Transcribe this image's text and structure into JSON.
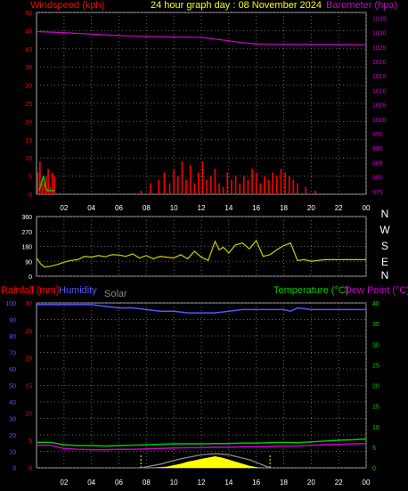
{
  "header": {
    "windspeed_label": "Windspeed (kph)",
    "title": "24 hour graph day : 08 November 2024",
    "barometer_label": "Barometer (hpa)"
  },
  "lower_header": {
    "rainfall_label": "Rainfall (mm)",
    "humidity_label": "Humidity",
    "solar_label": "Solar",
    "temperature_label": "Temperature (°C)",
    "dewpoint_label": "Dew Point (°C)"
  },
  "colors": {
    "wind": "#ff0000",
    "gust_green": "#00cc00",
    "barometer": "#cc00cc",
    "direction": "#cccc00",
    "humidity": "#5555ff",
    "temperature": "#00cc00",
    "dewpoint": "#cc00cc",
    "rain": "#ff0000",
    "solar": "#ffff00",
    "solar_max": "#888888",
    "grid": "#666666",
    "axis": "#aaaaaa"
  },
  "chart_data": [
    {
      "type": "line",
      "name": "wind-and-barometer",
      "x_ticks": [
        "02",
        "04",
        "06",
        "08",
        "10",
        "12",
        "14",
        "16",
        "18",
        "20",
        "22",
        "00"
      ],
      "y_left": {
        "ticks": [
          0,
          5,
          10,
          15,
          20,
          25,
          30,
          35,
          40,
          45,
          50
        ],
        "range": [
          0,
          50
        ]
      },
      "y_right": {
        "ticks": [
          975,
          980,
          985,
          990,
          995,
          1000,
          1005,
          1010,
          1015,
          1020,
          1025,
          1030,
          1035
        ],
        "range": [
          974,
          1037
        ]
      },
      "series": [
        {
          "name": "Barometer (hpa)",
          "x": [
            0,
            2,
            4,
            6,
            8,
            10,
            12,
            14,
            15,
            16,
            17,
            18,
            20,
            22,
            24
          ],
          "values": [
            1030.4,
            1030.0,
            1029.5,
            1029.0,
            1028.7,
            1028.5,
            1028.4,
            1027.2,
            1026.5,
            1026.1,
            1026.0,
            1026.0,
            1025.9,
            1025.9,
            1025.8
          ]
        },
        {
          "name": "Windspeed (kph)",
          "x": [
            0.1,
            0.25,
            0.4,
            0.55,
            0.7,
            0.85,
            1.0,
            1.15,
            1.3,
            7.6,
            8.3,
            8.9,
            9.3,
            9.7,
            10.0,
            10.3,
            10.6,
            10.9,
            11.2,
            11.5,
            11.8,
            12.1,
            12.4,
            12.7,
            13.0,
            13.3,
            13.6,
            13.9,
            14.2,
            14.5,
            14.8,
            15.1,
            15.4,
            15.7,
            16.0,
            16.3,
            16.6,
            16.9,
            17.2,
            17.5,
            17.8,
            18.1,
            18.4,
            18.7,
            19.0,
            19.6,
            20.3
          ],
          "values": [
            6,
            9,
            4,
            3,
            5,
            7,
            2,
            6,
            5,
            1,
            3,
            4,
            6,
            3,
            7,
            5,
            9,
            4,
            8,
            3,
            6,
            9,
            4,
            5,
            7,
            3,
            2,
            6,
            4,
            5,
            3,
            5,
            4,
            7,
            6,
            3,
            5,
            4,
            6,
            5,
            7,
            6,
            5,
            4,
            3,
            2,
            1
          ]
        },
        {
          "name": "Wind Gust",
          "x": [
            0.2,
            0.35,
            0.5,
            0.65,
            0.8,
            1.3
          ],
          "values": [
            1,
            3,
            5,
            2,
            1,
            1
          ]
        }
      ]
    },
    {
      "type": "line",
      "name": "wind-direction",
      "y_ticks": [
        0,
        90,
        180,
        270,
        360
      ],
      "compass": [
        "N",
        "W",
        "S",
        "E",
        "N"
      ],
      "range": [
        0,
        360
      ],
      "series": [
        {
          "name": "Wind Direction",
          "x": [
            0,
            0.3,
            0.6,
            1.0,
            1.5,
            2.0,
            2.5,
            3.0,
            3.5,
            4.0,
            4.5,
            5.0,
            5.5,
            6.0,
            6.5,
            7.0,
            7.5,
            8.0,
            8.5,
            9.0,
            9.5,
            10.0,
            10.5,
            11.0,
            11.5,
            12.0,
            12.5,
            13.0,
            13.3,
            13.6,
            14.0,
            14.5,
            15.0,
            15.5,
            16.0,
            16.5,
            17.0,
            17.5,
            18.0,
            18.5,
            19.0,
            19.5,
            20.0,
            21.0,
            22.0,
            23.0,
            24.0
          ],
          "values": [
            110,
            75,
            55,
            60,
            70,
            85,
            95,
            100,
            120,
            115,
            125,
            118,
            130,
            128,
            120,
            135,
            110,
            125,
            105,
            120,
            115,
            110,
            130,
            105,
            150,
            115,
            95,
            210,
            160,
            175,
            140,
            190,
            200,
            165,
            215,
            120,
            130,
            160,
            185,
            200,
            95,
            100,
            90,
            100,
            100,
            100,
            100
          ]
        }
      ]
    },
    {
      "type": "line",
      "name": "rain-humidity-temperature",
      "x_ticks": [
        "02",
        "04",
        "06",
        "08",
        "10",
        "12",
        "14",
        "16",
        "18",
        "20",
        "22",
        "00"
      ],
      "humidity_axis": {
        "ticks": [
          0,
          10,
          20,
          30,
          40,
          50,
          60,
          70,
          80,
          90,
          100
        ],
        "range": [
          0,
          100
        ]
      },
      "rain_axis": {
        "ticks": [
          0,
          5,
          10,
          15,
          20,
          25,
          30
        ],
        "range": [
          0,
          30
        ]
      },
      "temp_axis": {
        "ticks": [
          0,
          5,
          10,
          15,
          20,
          25,
          30,
          35,
          40
        ],
        "range": [
          0,
          40
        ]
      },
      "series": [
        {
          "name": "Humidity",
          "x": [
            0,
            2,
            4,
            5,
            6,
            7,
            8,
            9,
            10,
            11,
            12,
            13,
            14,
            15,
            16,
            17,
            18,
            18.5,
            19,
            20,
            21,
            22,
            23,
            24
          ],
          "values": [
            99,
            99,
            99,
            98,
            97,
            97,
            96,
            95,
            95,
            94,
            94,
            94,
            95,
            96,
            96,
            96,
            96,
            95,
            97,
            96,
            96,
            96,
            96,
            96
          ]
        },
        {
          "name": "Temperature (°C)",
          "x": [
            0,
            1,
            2,
            3,
            4,
            5,
            6,
            7,
            8,
            9,
            10,
            11,
            12,
            13,
            14,
            15,
            16,
            17,
            18,
            19,
            20,
            21,
            22,
            23,
            24
          ],
          "values": [
            6.2,
            6.2,
            5.6,
            5.4,
            5.4,
            5.3,
            5.4,
            5.5,
            5.6,
            5.7,
            5.8,
            5.8,
            5.8,
            5.9,
            5.9,
            6.0,
            6.0,
            6.1,
            6.2,
            6.1,
            6.3,
            6.5,
            6.7,
            6.8,
            7.0
          ]
        },
        {
          "name": "Dew Point (°C)",
          "x": [
            0,
            1,
            2,
            3,
            4,
            5,
            6,
            7,
            8,
            9,
            10,
            11,
            12,
            13,
            14,
            15,
            16,
            17,
            18,
            19,
            20,
            21,
            22,
            23,
            24
          ],
          "values": [
            5.5,
            5.5,
            4.7,
            4.5,
            4.4,
            4.4,
            4.5,
            4.5,
            4.6,
            4.7,
            4.8,
            4.9,
            4.9,
            5.0,
            5.0,
            5.1,
            5.1,
            5.2,
            5.3,
            5.3,
            5.5,
            5.6,
            5.7,
            5.8,
            5.9
          ]
        },
        {
          "name": "Solar",
          "x": [
            7.7,
            8.5,
            9.5,
            10.5,
            11.0,
            11.5,
            12.0,
            12.5,
            13.0,
            13.5,
            14.0,
            14.5,
            15.0,
            15.5,
            16.0,
            16.5
          ],
          "values": [
            0,
            0.5,
            3,
            10,
            15,
            18,
            22,
            25,
            28,
            25,
            20,
            15,
            10,
            5,
            2,
            0
          ]
        },
        {
          "name": "Solar Max",
          "x": [
            7.6,
            9,
            10.5,
            12.0,
            13.0,
            14.0,
            15.5,
            17.0
          ],
          "values": [
            0,
            20,
            50,
            72,
            78,
            72,
            45,
            0
          ]
        }
      ]
    }
  ]
}
